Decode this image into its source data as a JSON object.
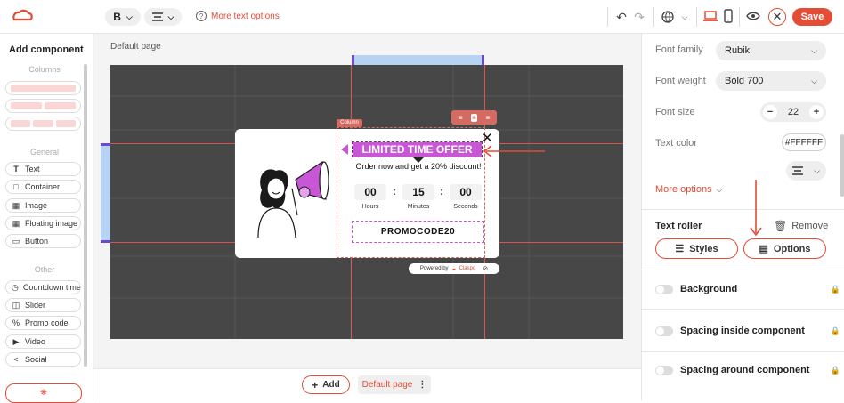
{
  "toolbar": {
    "bold_label": "B",
    "more_text_options": "More text options",
    "save_label": "Save"
  },
  "left_panel": {
    "title": "Add component",
    "columns_label": "Columns",
    "general_label": "General",
    "general_items": [
      {
        "label": "Text",
        "icon": "text-icon"
      },
      {
        "label": "Container",
        "icon": "container-icon"
      },
      {
        "label": "Image",
        "icon": "image-icon"
      },
      {
        "label": "Floating image",
        "icon": "floating-image-icon"
      },
      {
        "label": "Button",
        "icon": "button-icon"
      }
    ],
    "other_label": "Other",
    "other_items": [
      {
        "label": "Countdown timer",
        "icon": "countdown-icon"
      },
      {
        "label": "Slider",
        "icon": "slider-icon"
      },
      {
        "label": "Promo code",
        "icon": "percent-icon"
      },
      {
        "label": "Video",
        "icon": "play-icon"
      },
      {
        "label": "Social",
        "icon": "share-icon"
      }
    ]
  },
  "canvas": {
    "page_label": "Default page",
    "column_tag": "Column",
    "popup": {
      "headline": "LIMITED TIME OFFER",
      "subtext": "Order now and get a 20% discount!",
      "countdown": [
        {
          "value": "00",
          "unit": "Hours"
        },
        {
          "value": "15",
          "unit": "Minutes"
        },
        {
          "value": "00",
          "unit": "Seconds"
        }
      ],
      "promo_code": "PROMOCODE20",
      "powered_by": "Powered by",
      "brand": "Claspo"
    }
  },
  "bottom_bar": {
    "add_label": "Add",
    "page_label": "Default page"
  },
  "right_panel": {
    "font_family_label": "Font family",
    "font_family_value": "Rubik",
    "font_weight_label": "Font weight",
    "font_weight_value": "Bold 700",
    "font_size_label": "Font size",
    "font_size_value": "22",
    "text_color_label": "Text color",
    "text_color_value": "#FFFFFF",
    "more_options": "More options",
    "component_name": "Text roller",
    "remove_label": "Remove",
    "styles_label": "Styles",
    "options_label": "Options",
    "sections": [
      {
        "label": "Background"
      },
      {
        "label": "Spacing inside component"
      },
      {
        "label": "Spacing around component"
      }
    ]
  },
  "colors": {
    "accent": "#e34c36",
    "headline_bg": "#c857d6",
    "stage_bg": "#474747"
  }
}
